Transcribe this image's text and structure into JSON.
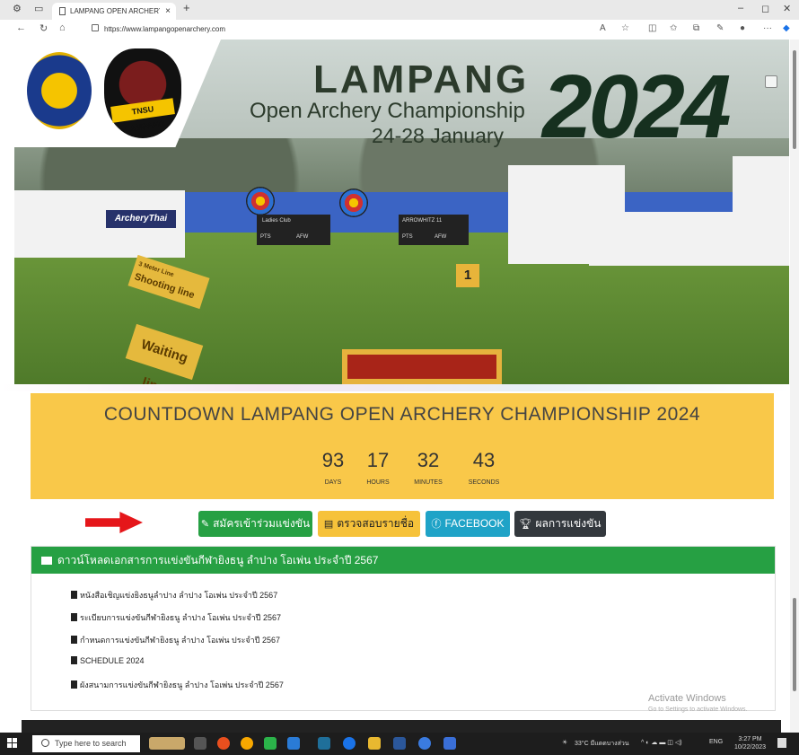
{
  "browser": {
    "tab_title": "LAMPANG OPEN ARCHERY CHA",
    "tab_close": "×",
    "new_tab": "+",
    "url": "https://www.lampangopenarchery.com",
    "window_controls": [
      "–",
      "◻",
      "✕"
    ],
    "nav_icons": [
      "back-icon",
      "refresh-icon",
      "home-icon"
    ]
  },
  "banner": {
    "title": "LAMPANG",
    "subtitle": "Open Archery Championship",
    "dates": "24-28 January",
    "year": "2024",
    "logo_text": "TNSU LAMPANG",
    "banner_signs": [
      "ArcheryThai",
      "3 Meter Line",
      "Shooting line",
      "Waiting line",
      "1"
    ],
    "board_text_1": "Ladies Club",
    "board_text_2": "ARROWHITZ 11",
    "board_pts": "PTS",
    "board_afw": "AFW"
  },
  "countdown": {
    "title": "COUNTDOWN LAMPANG OPEN ARCHERY CHAMPIONSHIP 2024",
    "units": [
      {
        "value": "93",
        "label": "DAYS"
      },
      {
        "value": "17",
        "label": "HOURS"
      },
      {
        "value": "32",
        "label": "MINUTES"
      },
      {
        "value": "43",
        "label": "SECONDS"
      }
    ]
  },
  "actions": {
    "register": "สมัครเข้าร่วมแข่งขัน",
    "check_list": "ตรวจสอบรายชื่อ",
    "facebook": "FACEBOOK",
    "results": "ผลการแข่งขัน"
  },
  "downloads": {
    "header": "ดาวน์โหลดเอกสารการแข่งขันกีฬายิงธนู ลำปาง โอเพ่น ประจำปี 2567",
    "items": [
      "หนังสือเชิญแข่งยิงธนูลำปาง ลำปาง โอเพ่น ประจำปี 2567",
      "ระเบียบการแข่งขันกีฬายิงธนู ลำปาง โอเพ่น ประจำปี 2567",
      "กำหนดการแข่งขันกีฬายิงธนู ลำปาง โอเพ่น ประจำปี 2567",
      "SCHEDULE 2024",
      "ผังสนามการแข่งขันกีฬายิงธนู ลำปาง โอเพ่น ประจำปี 2567"
    ]
  },
  "watermark": {
    "line1": "Activate Windows",
    "line2": "Go to Settings to activate Windows."
  },
  "taskbar": {
    "search_placeholder": "Type here to search",
    "weather": "33°C มีแดดบางส่วน",
    "lang": "ENG",
    "time": "3:27 PM",
    "date": "10/22/2023"
  },
  "colors": {
    "countdown_bg": "#f9c849",
    "green": "#26a043",
    "yellow_btn": "#f6c23a",
    "facebook": "#1fa3c7",
    "dark_btn": "#33383d",
    "arrow": "#e5161a"
  }
}
